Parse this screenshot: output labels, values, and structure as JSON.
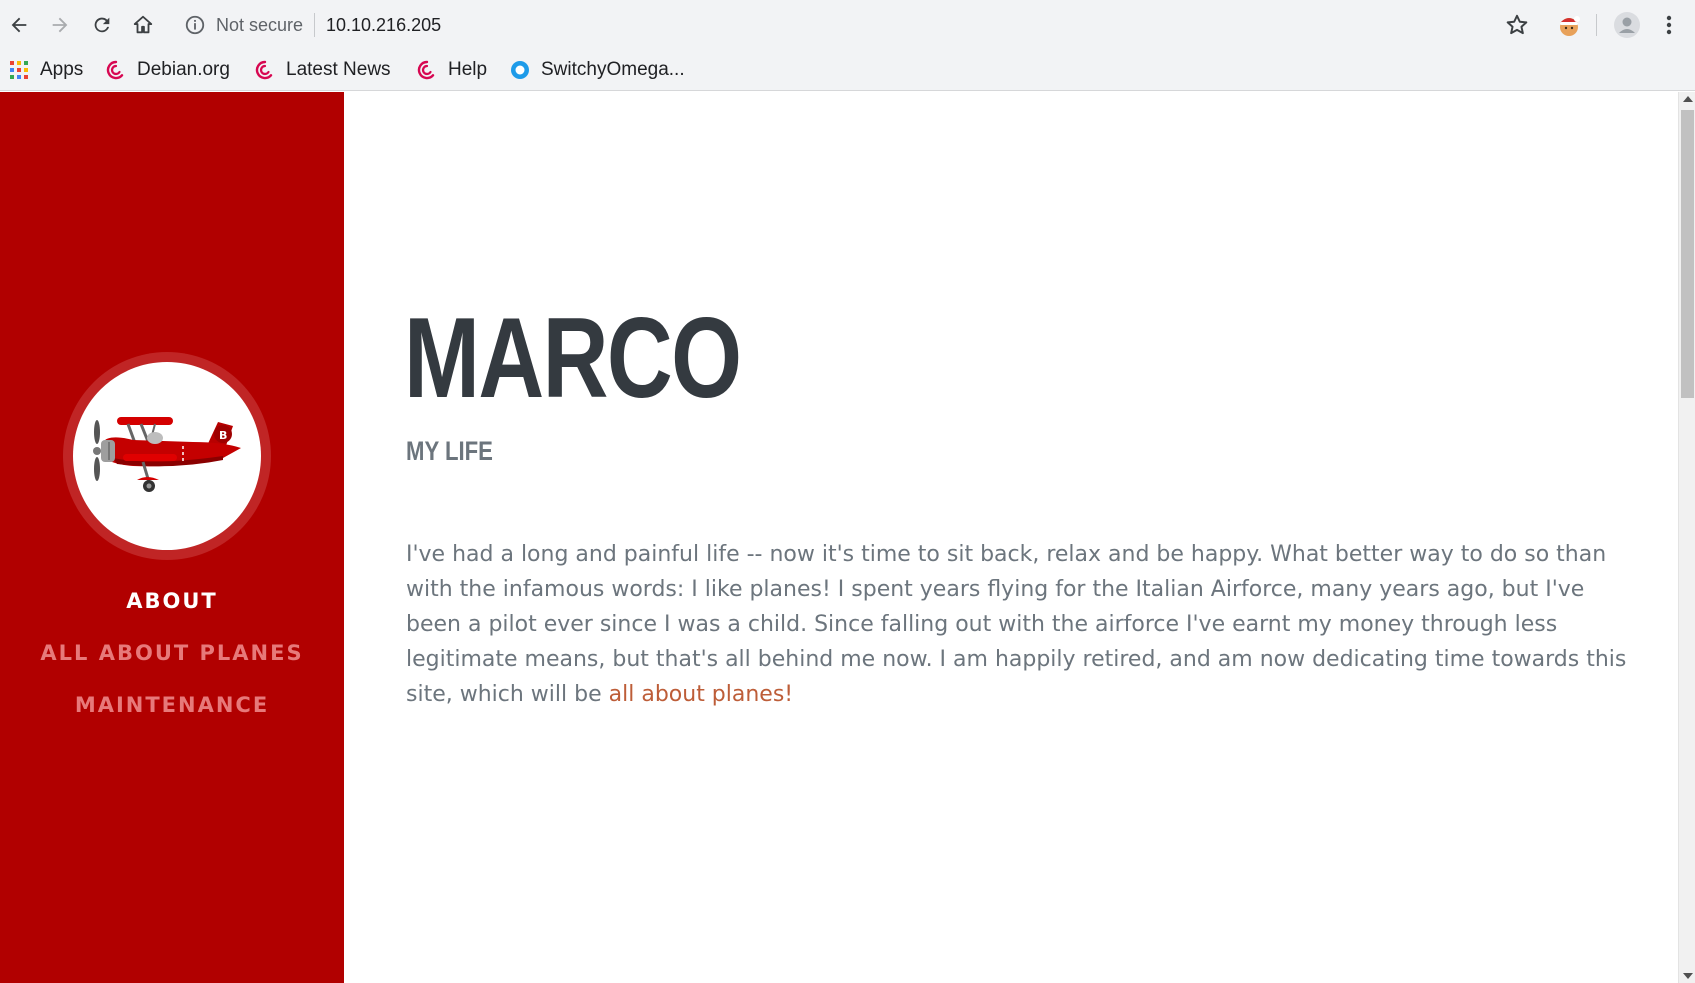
{
  "browser": {
    "security_label": "Not secure",
    "url": "10.10.216.205",
    "bookmarks": [
      {
        "label": "Apps",
        "icon": "apps-grid-icon"
      },
      {
        "label": "Debian.org",
        "icon": "debian-swirl-icon"
      },
      {
        "label": "Latest News",
        "icon": "debian-swirl-icon"
      },
      {
        "label": "Help",
        "icon": "debian-swirl-icon"
      },
      {
        "label": "SwitchyOmega...",
        "icon": "switchyomega-icon"
      }
    ]
  },
  "sidebar": {
    "background": "#b10000",
    "nav": [
      {
        "label": "ABOUT",
        "active": true
      },
      {
        "label": "ALL ABOUT PLANES",
        "active": false
      },
      {
        "label": "MAINTENANCE",
        "active": false
      }
    ]
  },
  "main": {
    "title": "MARCO",
    "subtitle": "MY LIFE",
    "paragraph": "I've had a long and painful life -- now it's time to sit back, relax and be happy. What better way to do so than with the infamous words: I like planes! I spent years flying for the Italian Airforce, many years ago, but I've been a pilot ever since I was a child. Since falling out with the airforce I've earnt my money through less legitimate means, but that's all behind me now. I am happily retired, and am now dedicating time towards this site, which will be",
    "link_text": "all about planes!",
    "link_color": "#bd5d38"
  }
}
